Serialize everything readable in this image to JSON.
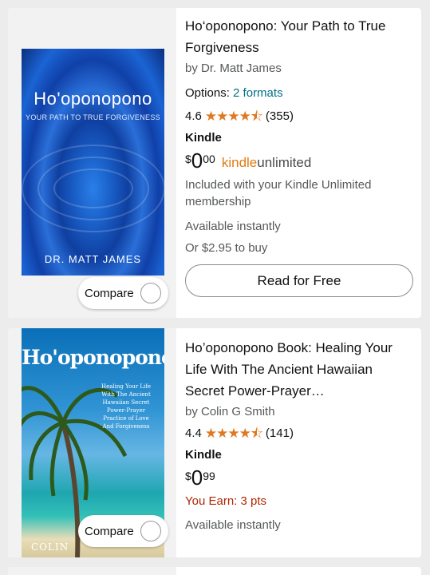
{
  "results": [
    {
      "cover": {
        "title": "Ho'oponopono",
        "subtitle": "YOUR PATH TO TRUE FORGIVENESS",
        "author": "DR. MATT JAMES"
      },
      "compare_label": "Compare",
      "title": "Ho‘oponopono: Your Path to True Forgiveness",
      "author": "by Dr. Matt James",
      "options_label": "Options:",
      "options_link": "2 formats",
      "rating": "4.6",
      "stars": "★★★★⯪",
      "review_count": "(355)",
      "format": "Kindle",
      "price": {
        "symbol": "$",
        "whole": "0",
        "fraction": "00"
      },
      "ku_logo": {
        "brand": "kindle",
        "suffix": "unlimited"
      },
      "included_text": "Included with your Kindle Unlimited membership",
      "availability": "Available instantly",
      "buy_text": "Or $2.95 to buy",
      "read_button": "Read for Free"
    },
    {
      "cover": {
        "title": "Ho'oponopono",
        "subtitle": "Healing Your Life With The Ancient Hawaiian Secret Power-Prayer Practice of Love And Forgiveness",
        "author": "COLIN"
      },
      "compare_label": "Compare",
      "title": "Ho’oponopono Book: Healing Your Life With The Ancient Hawaiian Secret Power-Prayer…",
      "author": "by Colin G Smith",
      "rating": "4.4",
      "stars": "★★★★⯪",
      "review_count": "(141)",
      "format": "Kindle",
      "price": {
        "symbol": "$",
        "whole": "0",
        "fraction": "99"
      },
      "earn_text": "You Earn: 3 pts",
      "availability": "Available instantly"
    }
  ],
  "colors": {
    "link": "#007185",
    "star": "#de7921",
    "earn": "#b12704",
    "ku": "#e47911"
  }
}
